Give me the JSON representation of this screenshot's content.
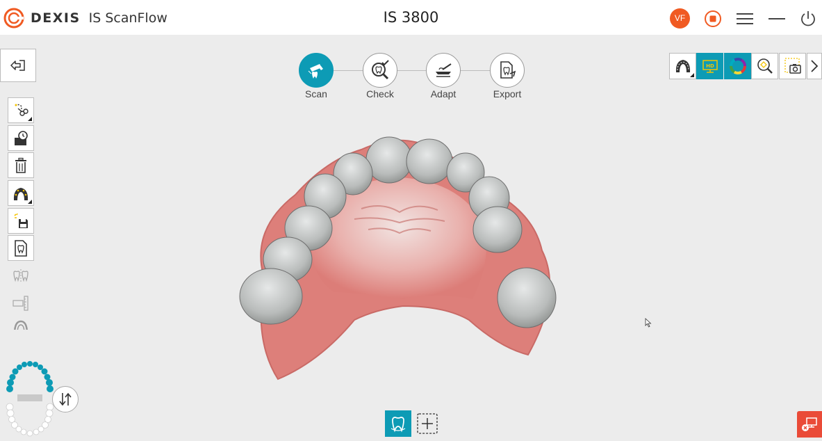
{
  "app": {
    "brand": "DEXIS",
    "product": "IS ScanFlow",
    "device": "IS 3800",
    "user_initials": "VF",
    "accent_color": "#0d9bb5",
    "logo_color": "#f05a22"
  },
  "window_controls": [
    "record-stop-icon",
    "menu-icon",
    "minimize-icon",
    "power-icon"
  ],
  "workflow": {
    "steps": [
      {
        "label": "Scan",
        "icon": "scanner-icon",
        "active": true
      },
      {
        "label": "Check",
        "icon": "check-magnifier-icon",
        "active": false
      },
      {
        "label": "Adapt",
        "icon": "adapt-icon",
        "active": false
      },
      {
        "label": "Export",
        "icon": "export-icon",
        "active": false
      }
    ]
  },
  "left_tools": [
    {
      "icon": "cut-tool-icon",
      "enabled": true
    },
    {
      "icon": "undo-history-icon",
      "enabled": true
    },
    {
      "icon": "trash-icon",
      "enabled": true
    },
    {
      "icon": "jaw-texture-icon",
      "enabled": true
    },
    {
      "icon": "save-icon",
      "enabled": true
    },
    {
      "icon": "tooth-document-icon",
      "enabled": true
    },
    {
      "icon": "occlusion-icon",
      "enabled": false
    },
    {
      "icon": "ruler-icon",
      "enabled": false
    },
    {
      "icon": "arch-icon",
      "enabled": false
    }
  ],
  "right_tools": [
    {
      "icon": "jaw-view-icon",
      "active": false
    },
    {
      "icon": "hd-display-icon",
      "active": true
    },
    {
      "icon": "color-wheel-icon",
      "active": true
    },
    {
      "icon": "zoom-icon",
      "active": false
    },
    {
      "icon": "screenshot-icon",
      "active": false
    },
    {
      "icon": "chevron-right-icon",
      "active": false
    }
  ],
  "bottom": {
    "tooth_mode": "tooth-icon",
    "add_mode": "add-region-icon",
    "swap_jaw": "swap-jaw-icon",
    "alert": "remote-alert-icon"
  }
}
